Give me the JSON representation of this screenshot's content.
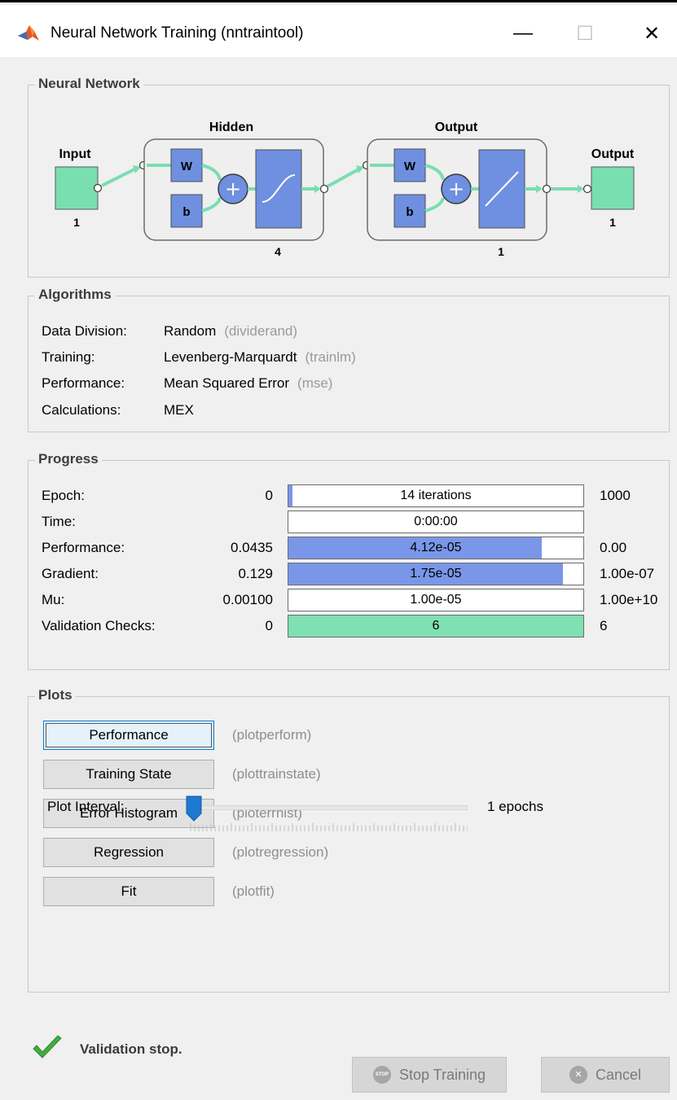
{
  "window": {
    "title": "Neural Network Training (nntraintool)",
    "minimize_glyph": "—",
    "maximize_glyph": "☐",
    "close_glyph": "✕"
  },
  "neural_network": {
    "group_title": "Neural Network",
    "input_label": "Input",
    "input_size": "1",
    "hidden_label": "Hidden",
    "hidden_size": "4",
    "output_layer_label": "Output",
    "output_layer_size": "1",
    "output_label": "Output",
    "output_size": "1",
    "weight_glyph": "W",
    "bias_glyph": "b",
    "plus_glyph": "+"
  },
  "algorithms": {
    "group_title": "Algorithms",
    "rows": [
      {
        "label": "Data Division:",
        "value": "Random",
        "hint": "(dividerand)"
      },
      {
        "label": "Training:",
        "value": "Levenberg-Marquardt",
        "hint": "(trainlm)"
      },
      {
        "label": "Performance:",
        "value": "Mean Squared Error",
        "hint": "(mse)"
      },
      {
        "label": "Calculations:",
        "value": "MEX",
        "hint": ""
      }
    ]
  },
  "progress": {
    "group_title": "Progress",
    "rows": [
      {
        "label": "Epoch:",
        "min": "0",
        "value": "14 iterations",
        "max": "1000",
        "fill": 0.014,
        "color": "#7a96e8"
      },
      {
        "label": "Time:",
        "min": "",
        "value": "0:00:00",
        "max": "",
        "fill": 0,
        "color": "#7a96e8"
      },
      {
        "label": "Performance:",
        "min": "0.0435",
        "value": "4.12e-05",
        "max": "0.00",
        "fill": 0.86,
        "color": "#7a96e8"
      },
      {
        "label": "Gradient:",
        "min": "0.129",
        "value": "1.75e-05",
        "max": "1.00e-07",
        "fill": 0.93,
        "color": "#7a96e8"
      },
      {
        "label": "Mu:",
        "min": "0.00100",
        "value": "1.00e-05",
        "max": "1.00e+10",
        "fill": 0,
        "color": "#7a96e8"
      },
      {
        "label": "Validation Checks:",
        "min": "0",
        "value": "6",
        "max": "6",
        "fill": 1.0,
        "color": "#7fe0b2"
      }
    ]
  },
  "plots": {
    "group_title": "Plots",
    "buttons": [
      {
        "label": "Performance",
        "hint": "(plotperform)"
      },
      {
        "label": "Training State",
        "hint": "(plottrainstate)"
      },
      {
        "label": "Error Histogram",
        "hint": "(ploterrhist)"
      },
      {
        "label": "Regression",
        "hint": "(plotregression)"
      },
      {
        "label": "Fit",
        "hint": "(plotfit)"
      }
    ],
    "interval_label": "Plot Interval:",
    "interval_value": "1 epochs",
    "interval_position": 0
  },
  "status": {
    "message": "Validation stop.",
    "icon": "checkmark-icon"
  },
  "footer": {
    "stop_label": "Stop Training",
    "stop_icon_text": "STOP",
    "cancel_label": "Cancel",
    "cancel_icon_text": "✕"
  },
  "colors": {
    "node_green": "#79deb0",
    "layer_blue": "#6f8fe0",
    "accent_blue": "#1f78d1"
  }
}
